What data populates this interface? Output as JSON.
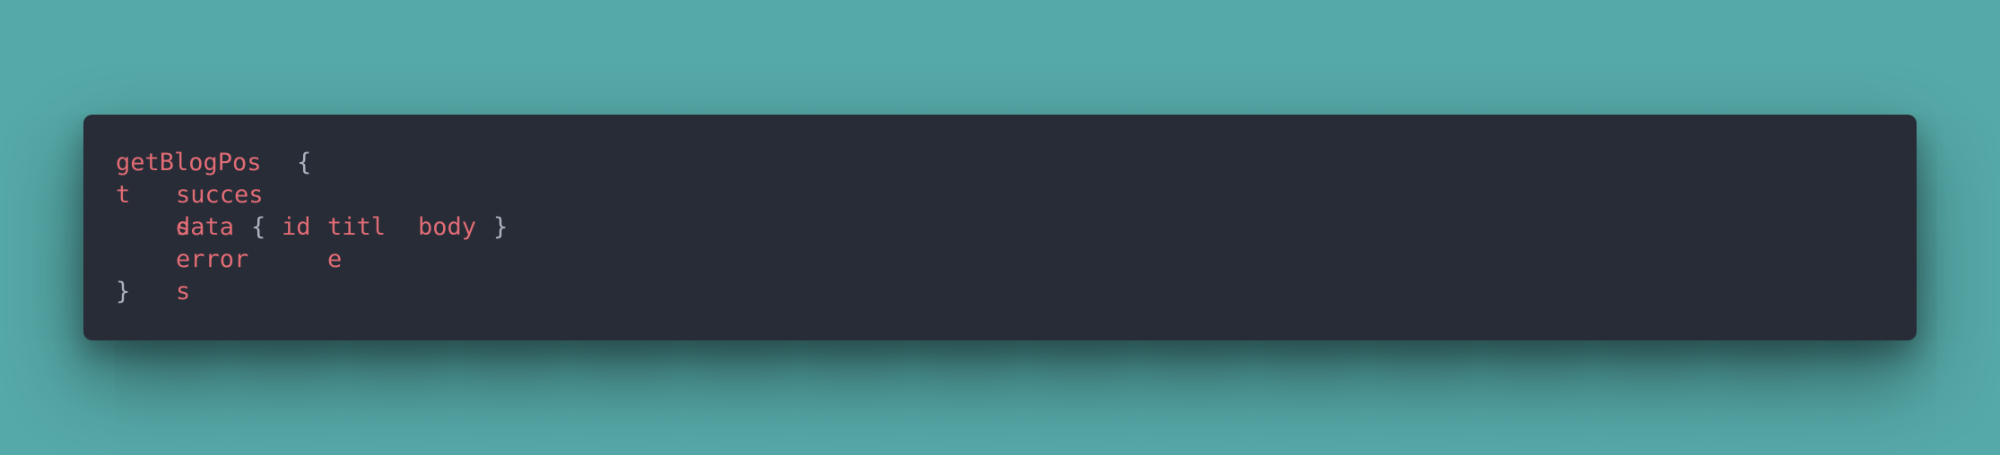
{
  "colors": {
    "background": "#55a9a8",
    "window": "#282c36",
    "field": "#e06c75",
    "punctuation": "#abb2bf"
  },
  "code": {
    "query_name_1": "getBlogPos",
    "query_name_2": "t",
    "open_brace": "{",
    "success_1": "succes",
    "success_2": "s",
    "data_field": "data",
    "data_open_brace": "{",
    "id_field": "id",
    "title_1": "titl",
    "title_2": "e",
    "body_field": "body",
    "data_close_brace": "}",
    "errors_1": "error",
    "errors_2": "s",
    "close_brace": "}"
  }
}
